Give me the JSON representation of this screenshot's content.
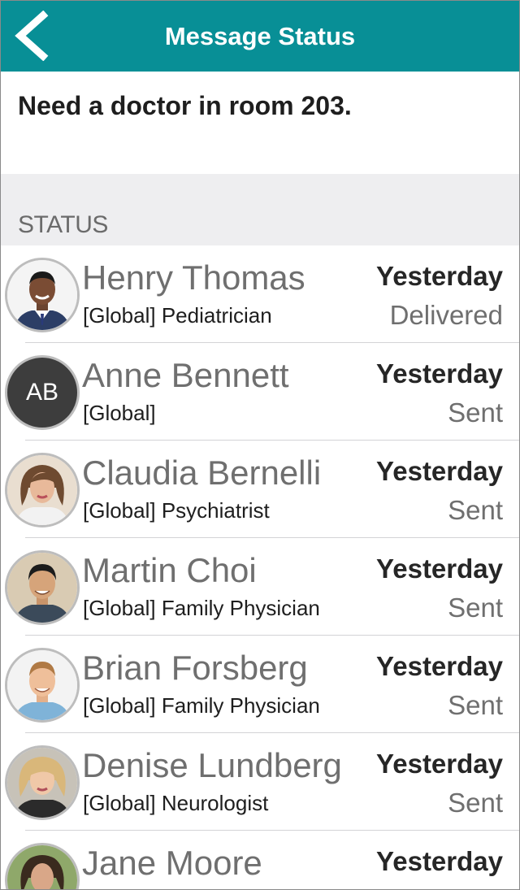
{
  "header": {
    "title": "Message Status",
    "back_icon": "chevron-left-icon",
    "color": "#088f96"
  },
  "message": {
    "text": "Need a doctor in room 203."
  },
  "section": {
    "label": "STATUS"
  },
  "recipients": [
    {
      "name": "Henry Thomas",
      "role": "[Global] Pediatrician",
      "time": "Yesterday",
      "status": "Delivered",
      "avatar": "photo"
    },
    {
      "name": "Anne Bennett",
      "role": "[Global]",
      "time": "Yesterday",
      "status": "Sent",
      "avatar": "initials",
      "initials": "AB"
    },
    {
      "name": "Claudia Bernelli",
      "role": "[Global] Psychiatrist",
      "time": "Yesterday",
      "status": "Sent",
      "avatar": "photo"
    },
    {
      "name": "Martin Choi",
      "role": "[Global] Family Physician",
      "time": "Yesterday",
      "status": "Sent",
      "avatar": "photo"
    },
    {
      "name": "Brian Forsberg",
      "role": "[Global] Family Physician",
      "time": "Yesterday",
      "status": "Sent",
      "avatar": "photo"
    },
    {
      "name": "Denise Lundberg",
      "role": "[Global] Neurologist",
      "time": "Yesterday",
      "status": "Sent",
      "avatar": "photo"
    },
    {
      "name": "Jane Moore",
      "role": "",
      "time": "Yesterday",
      "status": "",
      "avatar": "photo"
    }
  ]
}
